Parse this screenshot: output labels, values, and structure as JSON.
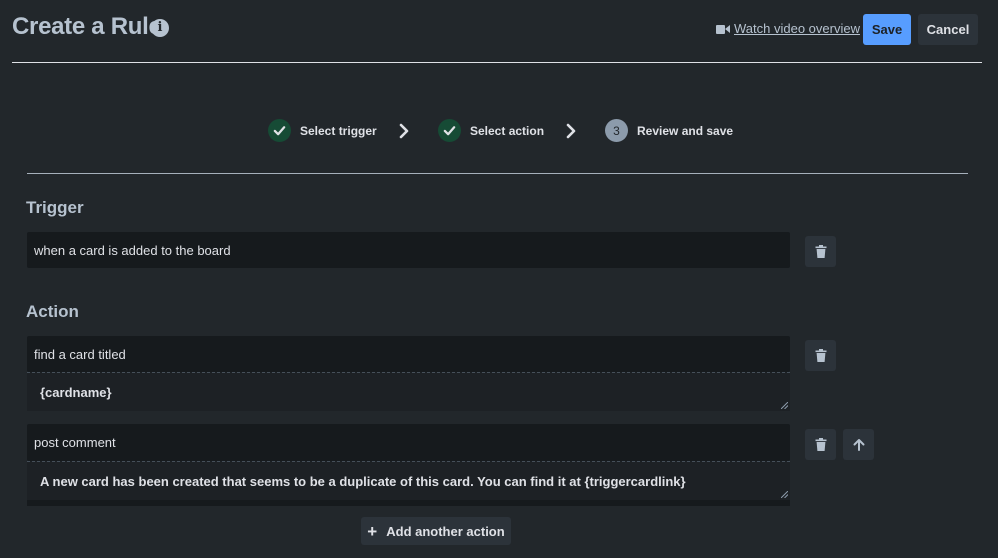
{
  "header": {
    "title": "Create a Rule",
    "info_icon": "i",
    "video_link": "Watch video overview",
    "save_label": "Save",
    "cancel_label": "Cancel"
  },
  "steps": [
    {
      "label": "Select trigger",
      "state": "complete",
      "icon": "check-icon"
    },
    {
      "label": "Select action",
      "state": "complete",
      "icon": "check-icon"
    },
    {
      "label": "Review and save",
      "state": "current",
      "number": "3"
    }
  ],
  "trigger": {
    "heading": "Trigger",
    "text": "when a card is added to the board"
  },
  "action": {
    "heading": "Action",
    "items": [
      {
        "text": "find a card titled",
        "value": "{cardname}"
      },
      {
        "text": "post comment",
        "value": "A new card has been created that seems to be a duplicate of this card. You can find it at {triggercardlink}"
      }
    ],
    "add_label": "Add another action"
  },
  "colors": {
    "background": "#22272b",
    "primary": "#579dff",
    "step_complete": "#164b35",
    "step_current": "#8c9bab",
    "field_bg": "#161a1d"
  }
}
